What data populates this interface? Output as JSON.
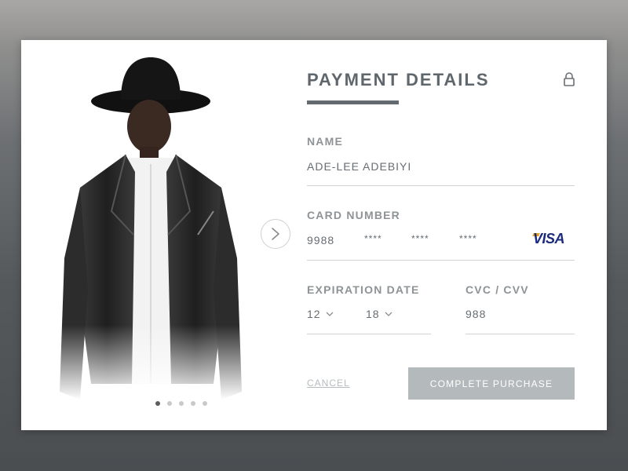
{
  "form": {
    "title": "PAYMENT DETAILS",
    "name_label": "NAME",
    "name_value": "ADE-LEE ADEBIYI",
    "card_label": "CARD NUMBER",
    "card_groups": [
      "9988",
      "****",
      "****",
      "****"
    ],
    "card_brand": "VISA",
    "expiration_label": "EXPIRATION DATE",
    "exp_month": "12",
    "exp_year": "18",
    "cvc_label": "CVC / CVV",
    "cvc_value": "988",
    "cancel_label": "CANCEL",
    "complete_label": "COMPLETE PURCHASE"
  },
  "carousel": {
    "slides": 5,
    "active_slide": 1
  },
  "icons": [
    "lock-icon",
    "chevron-right-icon",
    "chevron-down-icon"
  ],
  "colors": {
    "accent": "#636a70",
    "label": "#8e9396",
    "button": "#b4b9bb",
    "visa_blue": "#1a2a7c",
    "visa_gold": "#e8a31e"
  }
}
